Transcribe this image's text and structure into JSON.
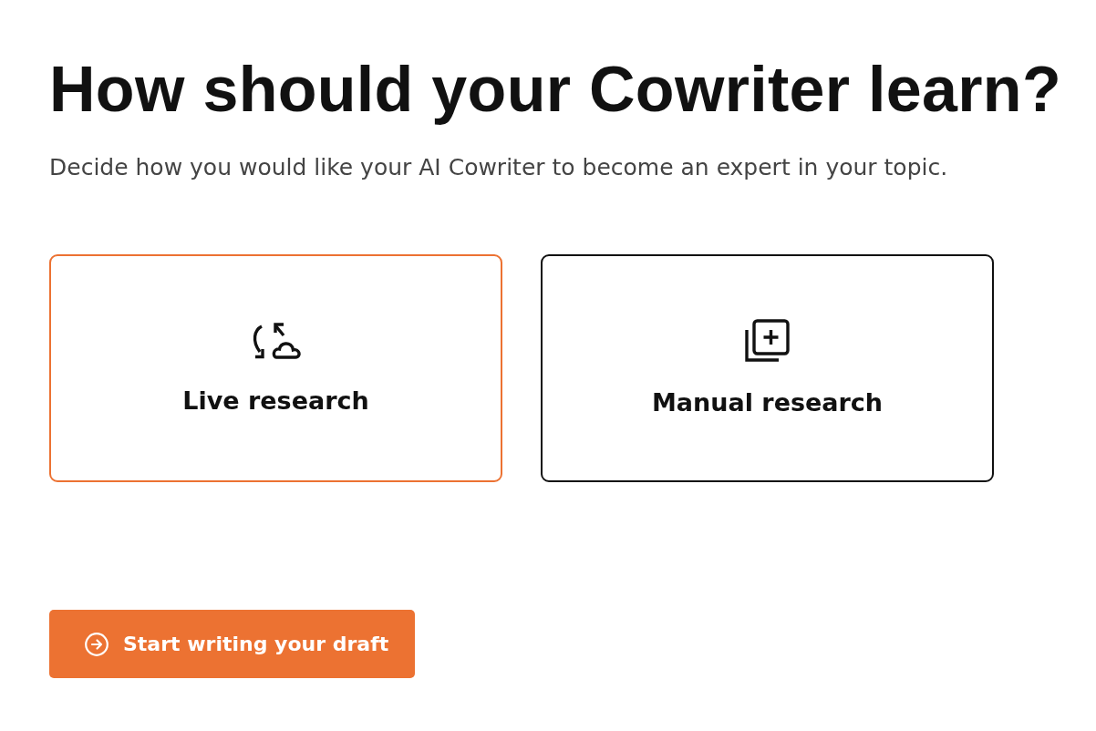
{
  "title": "How should your Cowriter learn?",
  "subtitle": "Decide how you would like your AI Cowriter to become an expert in your topic.",
  "options": [
    {
      "kind": "sync",
      "label": "Live research",
      "selected": true
    },
    {
      "kind": "add",
      "label": "Manual research",
      "selected": false
    }
  ],
  "primary_button": {
    "label": "Start writing your draft"
  }
}
